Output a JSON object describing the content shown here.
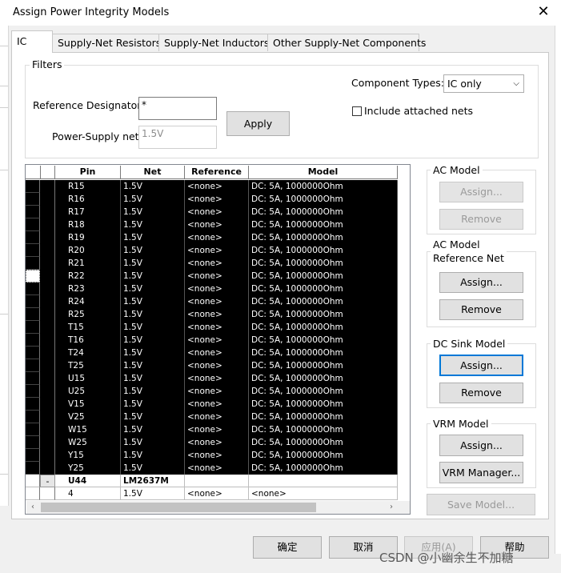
{
  "window": {
    "title": "Assign Power Integrity Models",
    "close_glyph": "✕"
  },
  "tabs": [
    {
      "label": "IC"
    },
    {
      "label": "Supply-Net Resistors"
    },
    {
      "label": "Supply-Net Inductors"
    },
    {
      "label": "Other Supply-Net Components"
    }
  ],
  "filters": {
    "legend": "Filters",
    "refdes_label": "Reference Designator:",
    "refdes_value": "*",
    "psnet_label": "Power-Supply net:",
    "psnet_value": "1.5V",
    "apply_label": "Apply",
    "component_types_label": "Component Types:",
    "component_types_value": "IC only",
    "include_attached_label": "Include attached nets",
    "include_attached_checked": false
  },
  "grid": {
    "columns": [
      "Pin",
      "Net",
      "Reference",
      "Model"
    ],
    "rows": [
      {
        "pin": "R15",
        "net": "1.5V",
        "ref": "<none>",
        "model": "DC: 5A, 1000000Ohm"
      },
      {
        "pin": "R16",
        "net": "1.5V",
        "ref": "<none>",
        "model": "DC: 5A, 1000000Ohm"
      },
      {
        "pin": "R17",
        "net": "1.5V",
        "ref": "<none>",
        "model": "DC: 5A, 1000000Ohm"
      },
      {
        "pin": "R18",
        "net": "1.5V",
        "ref": "<none>",
        "model": "DC: 5A, 1000000Ohm"
      },
      {
        "pin": "R19",
        "net": "1.5V",
        "ref": "<none>",
        "model": "DC: 5A, 1000000Ohm"
      },
      {
        "pin": "R20",
        "net": "1.5V",
        "ref": "<none>",
        "model": "DC: 5A, 1000000Ohm"
      },
      {
        "pin": "R21",
        "net": "1.5V",
        "ref": "<none>",
        "model": "DC: 5A, 1000000Ohm"
      },
      {
        "pin": "R22",
        "net": "1.5V",
        "ref": "<none>",
        "model": "DC: 5A, 1000000Ohm"
      },
      {
        "pin": "R23",
        "net": "1.5V",
        "ref": "<none>",
        "model": "DC: 5A, 1000000Ohm"
      },
      {
        "pin": "R24",
        "net": "1.5V",
        "ref": "<none>",
        "model": "DC: 5A, 1000000Ohm"
      },
      {
        "pin": "R25",
        "net": "1.5V",
        "ref": "<none>",
        "model": "DC: 5A, 1000000Ohm"
      },
      {
        "pin": "T15",
        "net": "1.5V",
        "ref": "<none>",
        "model": "DC: 5A, 1000000Ohm"
      },
      {
        "pin": "T16",
        "net": "1.5V",
        "ref": "<none>",
        "model": "DC: 5A, 1000000Ohm"
      },
      {
        "pin": "T24",
        "net": "1.5V",
        "ref": "<none>",
        "model": "DC: 5A, 1000000Ohm"
      },
      {
        "pin": "T25",
        "net": "1.5V",
        "ref": "<none>",
        "model": "DC: 5A, 1000000Ohm"
      },
      {
        "pin": "U15",
        "net": "1.5V",
        "ref": "<none>",
        "model": "DC: 5A, 1000000Ohm"
      },
      {
        "pin": "U25",
        "net": "1.5V",
        "ref": "<none>",
        "model": "DC: 5A, 1000000Ohm"
      },
      {
        "pin": "V15",
        "net": "1.5V",
        "ref": "<none>",
        "model": "DC: 5A, 1000000Ohm"
      },
      {
        "pin": "V25",
        "net": "1.5V",
        "ref": "<none>",
        "model": "DC: 5A, 1000000Ohm"
      },
      {
        "pin": "W15",
        "net": "1.5V",
        "ref": "<none>",
        "model": "DC: 5A, 1000000Ohm"
      },
      {
        "pin": "W25",
        "net": "1.5V",
        "ref": "<none>",
        "model": "DC: 5A, 1000000Ohm"
      },
      {
        "pin": "Y15",
        "net": "1.5V",
        "ref": "<none>",
        "model": "DC: 5A, 1000000Ohm"
      },
      {
        "pin": "Y25",
        "net": "1.5V",
        "ref": "<none>",
        "model": "DC: 5A, 1000000Ohm"
      }
    ],
    "group_row": {
      "expander": "-",
      "pin": "U44",
      "net": "LM2637M",
      "ref": "",
      "model": ""
    },
    "child_row": {
      "pin": "4",
      "net": "1.5V",
      "ref": "<none>",
      "model": "<none>"
    }
  },
  "side": {
    "ac_model_legend": "AC Model",
    "ac_assign": "Assign...",
    "ac_remove": "Remove",
    "ac_ref_legend_1": "AC Model",
    "ac_ref_legend_2": "Reference Net",
    "acref_assign": "Assign...",
    "acref_remove": "Remove",
    "dc_legend": "DC Sink Model",
    "dc_assign": "Assign...",
    "dc_remove": "Remove",
    "vrm_legend": "VRM Model",
    "vrm_assign": "Assign...",
    "vrm_manager": "VRM Manager...",
    "save_model": "Save Model..."
  },
  "footer": {
    "ok": "确定",
    "cancel": "取消",
    "apply": "应用(A)",
    "help": "帮助",
    "watermark": "CSDN @小幽余生不加糖"
  },
  "colors": {
    "selection_bg": "#000000",
    "focus_border": "#0078d7"
  }
}
